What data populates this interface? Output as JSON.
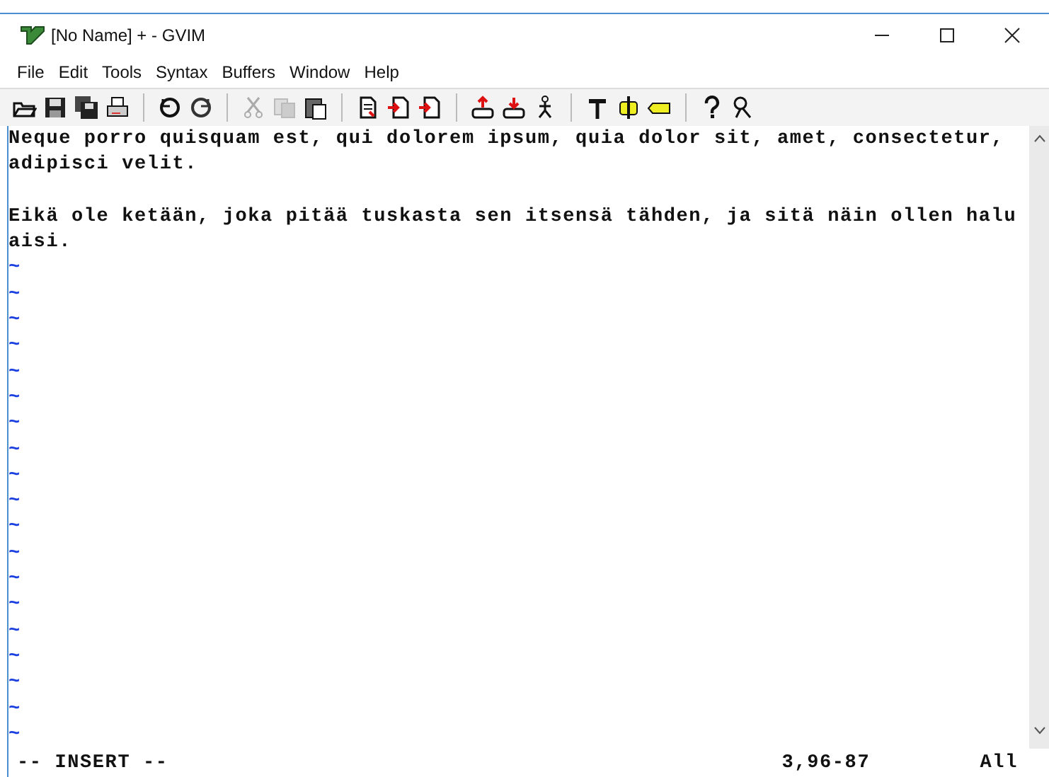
{
  "window": {
    "title": "[No Name] + - GVIM"
  },
  "menu": [
    {
      "label": "File"
    },
    {
      "label": "Edit"
    },
    {
      "label": "Tools"
    },
    {
      "label": "Syntax"
    },
    {
      "label": "Buffers"
    },
    {
      "label": "Window"
    },
    {
      "label": "Help"
    }
  ],
  "rows": [
    {
      "kind": "text",
      "text": "Neque porro quisquam est, qui dolorem ipsum, quia dolor sit, amet, consectetur,"
    },
    {
      "kind": "text",
      "text": "adipisci velit."
    },
    {
      "kind": "empty"
    },
    {
      "kind": "text",
      "text": "Eikä ole ketään, joka pitää tuskasta sen itsensä tähden, ja sitä näin ollen halu"
    },
    {
      "kind": "text",
      "text": "aisi."
    },
    {
      "kind": "filler",
      "text": "~"
    },
    {
      "kind": "filler",
      "text": "~"
    },
    {
      "kind": "filler",
      "text": "~"
    },
    {
      "kind": "filler",
      "text": "~"
    },
    {
      "kind": "filler",
      "text": "~"
    },
    {
      "kind": "filler",
      "text": "~"
    },
    {
      "kind": "filler",
      "text": "~"
    },
    {
      "kind": "filler",
      "text": "~"
    },
    {
      "kind": "filler",
      "text": "~"
    },
    {
      "kind": "filler",
      "text": "~"
    },
    {
      "kind": "filler",
      "text": "~"
    },
    {
      "kind": "filler",
      "text": "~"
    },
    {
      "kind": "filler",
      "text": "~"
    },
    {
      "kind": "filler",
      "text": "~"
    },
    {
      "kind": "filler",
      "text": "~"
    },
    {
      "kind": "filler",
      "text": "~"
    },
    {
      "kind": "filler",
      "text": "~"
    },
    {
      "kind": "filler",
      "text": "~"
    },
    {
      "kind": "filler",
      "text": "~"
    }
  ],
  "status_line": {
    "mode": "-- INSERT --",
    "position": "3,96-87",
    "scroll": "All"
  }
}
